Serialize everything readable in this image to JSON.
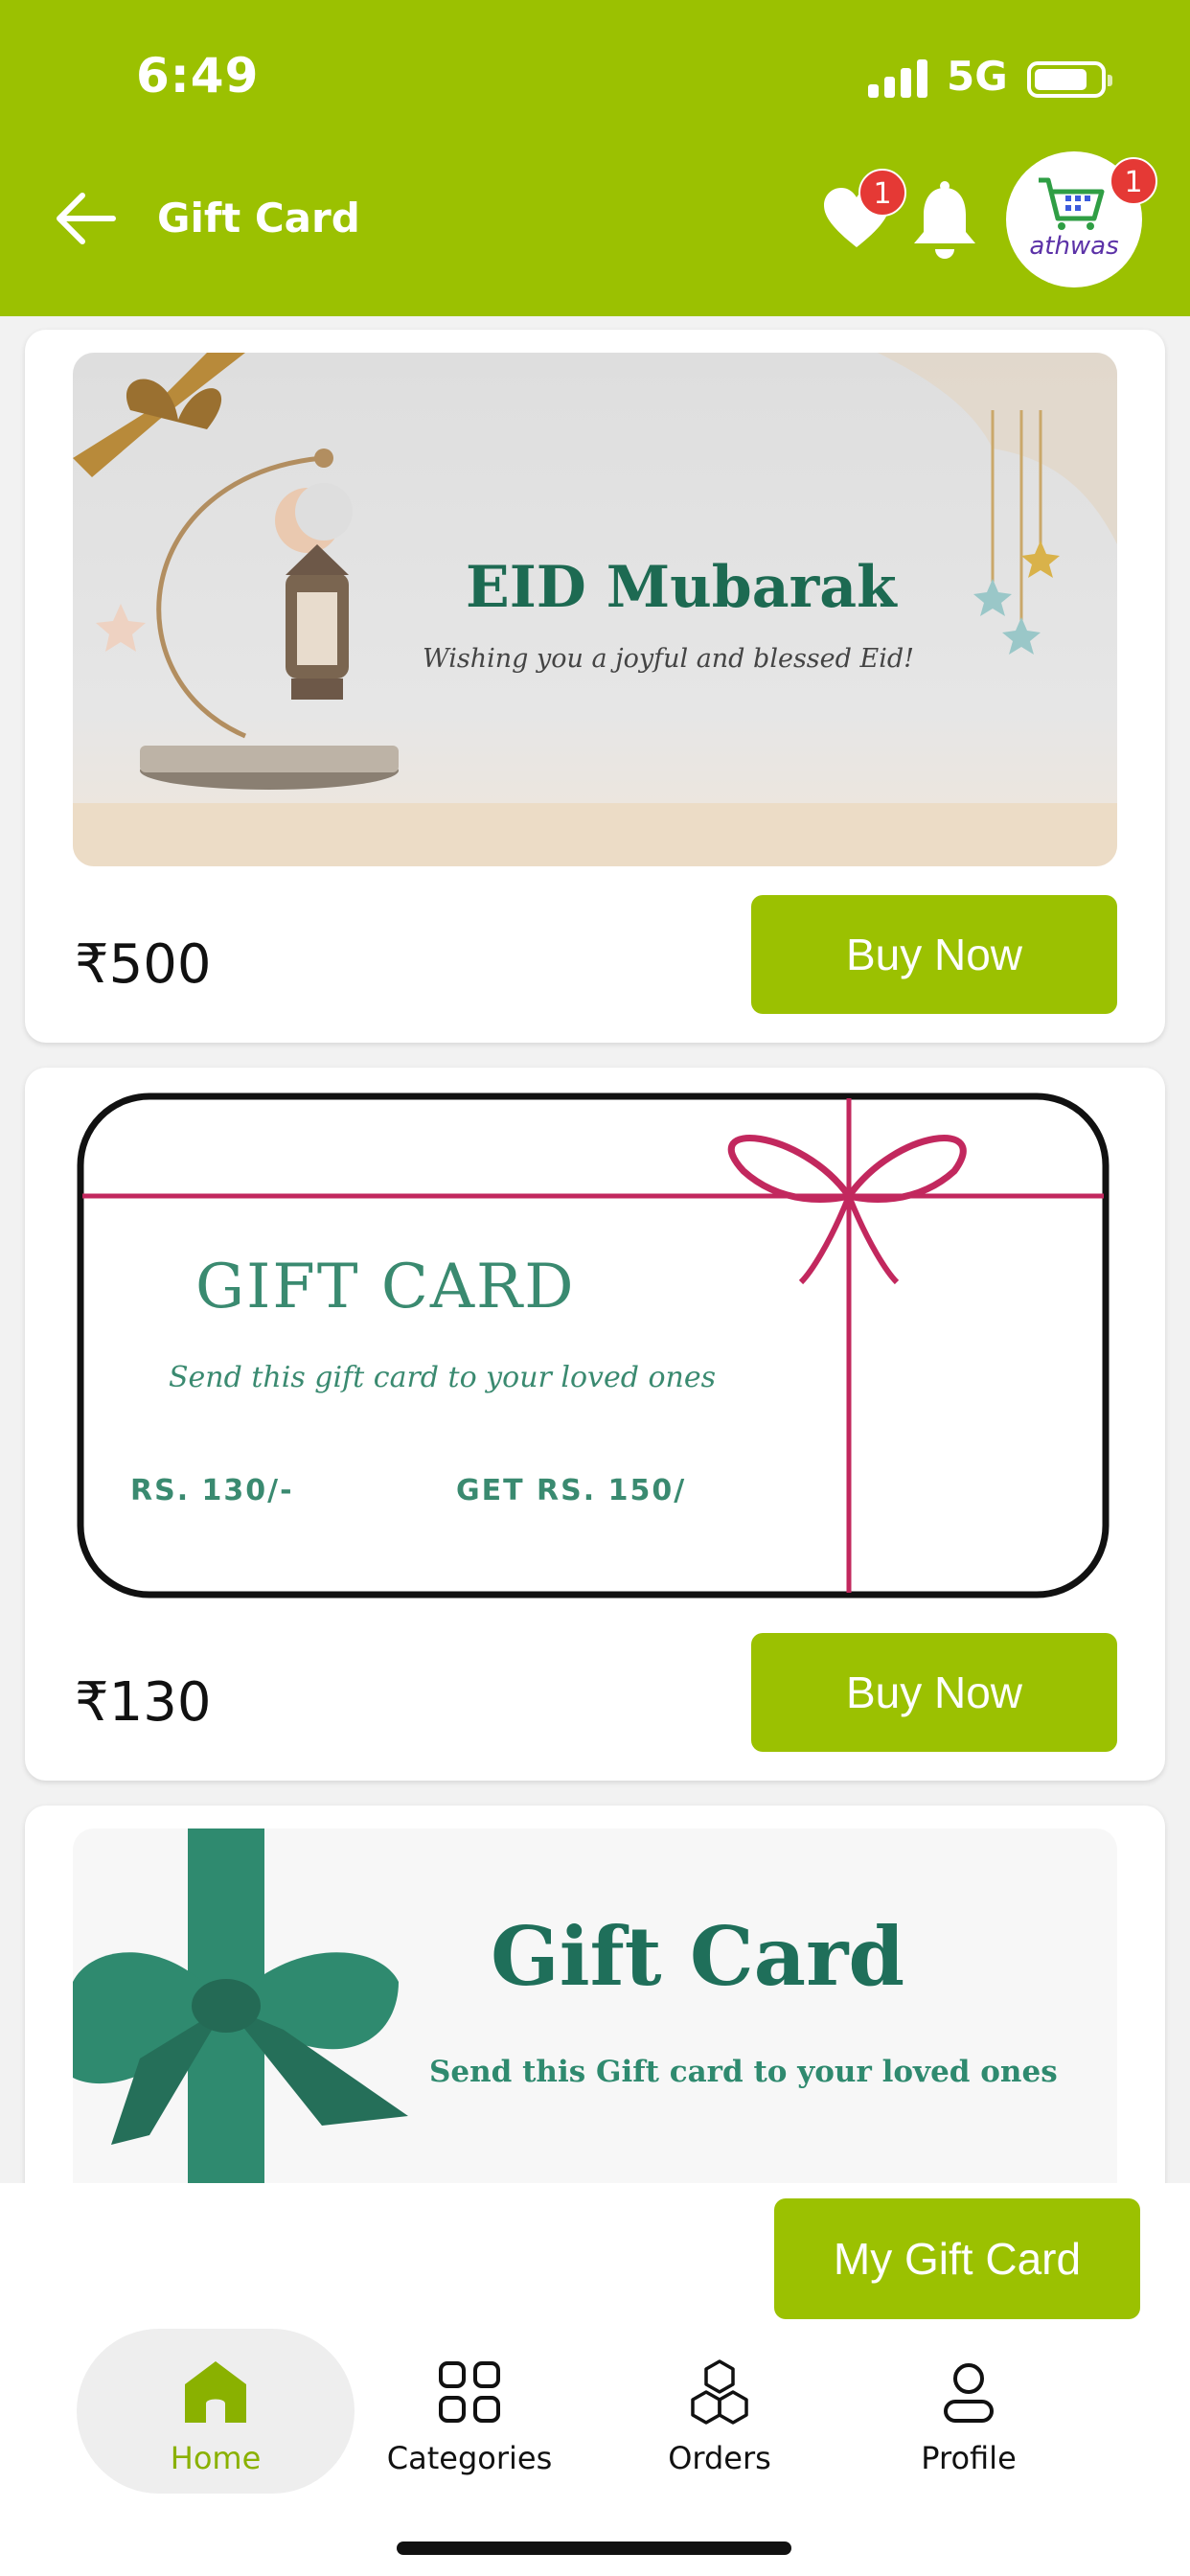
{
  "status_bar": {
    "time": "6:49",
    "network": "5G"
  },
  "header": {
    "title": "Gift Card",
    "wishlist_badge": "1",
    "cart_badge": "1",
    "avatar_text": "athwas"
  },
  "colors": {
    "brand_green": "#9bc101",
    "badge_red": "#e53935",
    "teal": "#2f7d66"
  },
  "gift_cards": [
    {
      "image_title": "EID Mubarak",
      "image_subtitle": "Wishing you a joyful and blessed Eid!",
      "price": "₹500",
      "button": "Buy Now"
    },
    {
      "image_title": "GIFT CARD",
      "image_subtitle": "Send this gift card to your loved ones",
      "image_offer_left": "RS. 130/-",
      "image_offer_right": "GET RS. 150/",
      "price": "₹130",
      "button": "Buy Now"
    },
    {
      "image_title": "Gift Card",
      "image_subtitle": "Send this Gift card to your loved ones"
    }
  ],
  "my_gift_card_button": "My Gift Card",
  "nav": [
    {
      "label": "Home",
      "icon": "home-icon",
      "active": true
    },
    {
      "label": "Categories",
      "icon": "grid-icon"
    },
    {
      "label": "Orders",
      "icon": "boxes-icon"
    },
    {
      "label": "Profile",
      "icon": "user-icon"
    }
  ]
}
